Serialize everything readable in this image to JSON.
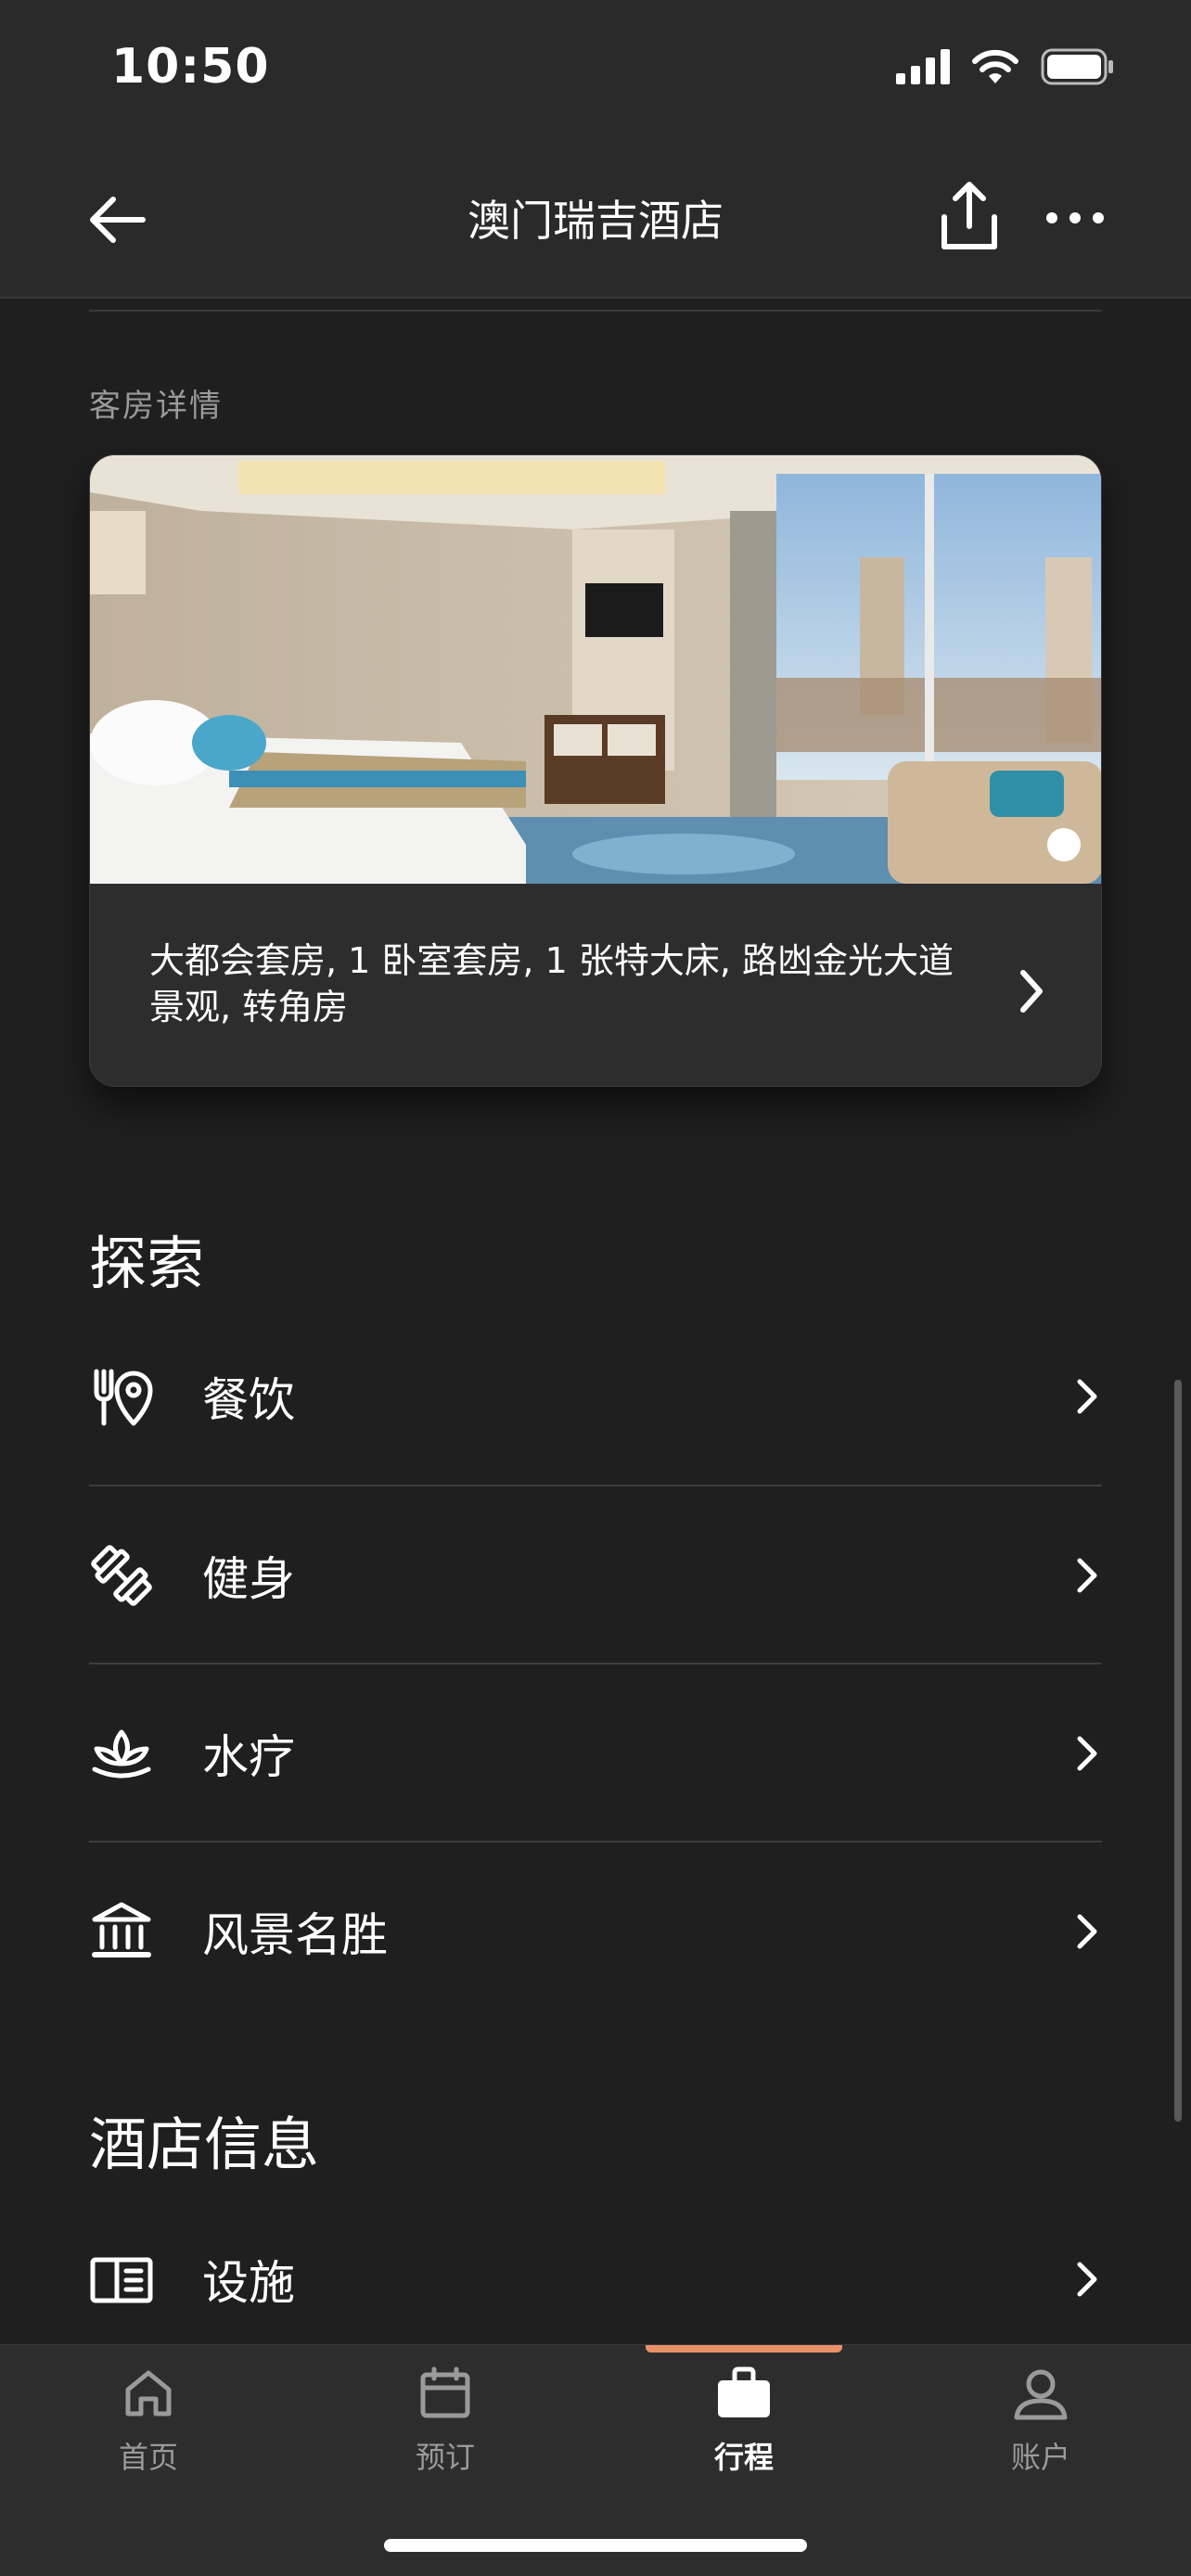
{
  "status_bar": {
    "time": "10:50"
  },
  "nav": {
    "title": "澳门瑞吉酒店"
  },
  "room": {
    "caption": "客房详情",
    "description": "大都会套房, 1 卧室套房, 1 张特大床, 路凼金光大道景观, 转角房"
  },
  "explore": {
    "title": "探索",
    "items": [
      {
        "label": "餐饮",
        "icon": "dining-location-icon"
      },
      {
        "label": "健身",
        "icon": "dumbbell-icon"
      },
      {
        "label": "水疗",
        "icon": "lotus-icon"
      },
      {
        "label": "风景名胜",
        "icon": "landmark-icon"
      }
    ]
  },
  "hotel_info": {
    "title": "酒店信息",
    "items": [
      {
        "label": "设施",
        "icon": "facilities-icon"
      }
    ]
  },
  "tabs": [
    {
      "label": "首页",
      "icon": "home-icon"
    },
    {
      "label": "预订",
      "icon": "calendar-icon"
    },
    {
      "label": "行程",
      "icon": "briefcase-icon",
      "active": true
    },
    {
      "label": "账户",
      "icon": "person-icon"
    }
  ],
  "colors": {
    "background": "#1f1f1f",
    "bar": "#2a2a2a",
    "accent": "#e8926a"
  }
}
